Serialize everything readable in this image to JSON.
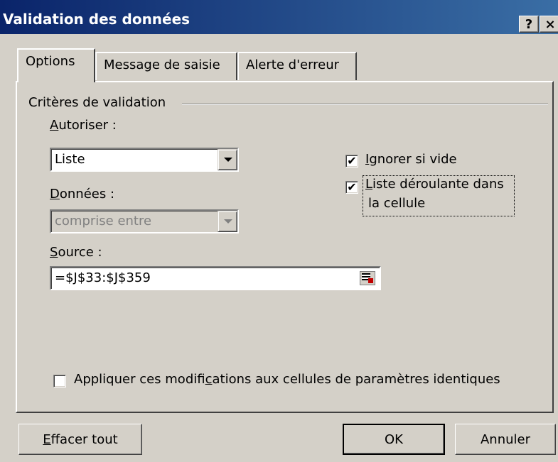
{
  "window": {
    "title": "Validation des données",
    "help_label": "?",
    "close_label": "×"
  },
  "tabs": [
    {
      "label": "Options",
      "active": true
    },
    {
      "label": "Message de saisie",
      "active": false
    },
    {
      "label": "Alerte d'erreur",
      "active": false
    }
  ],
  "criteria": {
    "group_label": "Critères de validation",
    "allow": {
      "label_mnemonic": "A",
      "label_rest": "utoriser :",
      "value": "Liste"
    },
    "data": {
      "label_mnemonic": "D",
      "label_rest": "onnées :",
      "value": "comprise entre",
      "disabled": true
    },
    "source": {
      "label_mnemonic": "S",
      "label_rest": "ource :",
      "value": "=$J$33:$J$359"
    },
    "ignore_blank": {
      "label_mnemonic": "I",
      "label_rest": "gnorer si vide",
      "checked": true
    },
    "in_cell_dropdown": {
      "label_mnemonic": "L",
      "label_line1_rest": "iste déroulante dans",
      "label_line2": "la cellule",
      "checked": true
    },
    "apply_changes": {
      "label_before": "Appliquer ces modifi",
      "label_mnemonic": "c",
      "label_after": "ations aux cellules de paramètres identiques",
      "checked": false
    }
  },
  "buttons": {
    "clear_mnemonic": "E",
    "clear_rest": "ffacer tout",
    "ok_label": "OK",
    "cancel_label": "Annuler"
  },
  "checkmark_glyph": "✔"
}
